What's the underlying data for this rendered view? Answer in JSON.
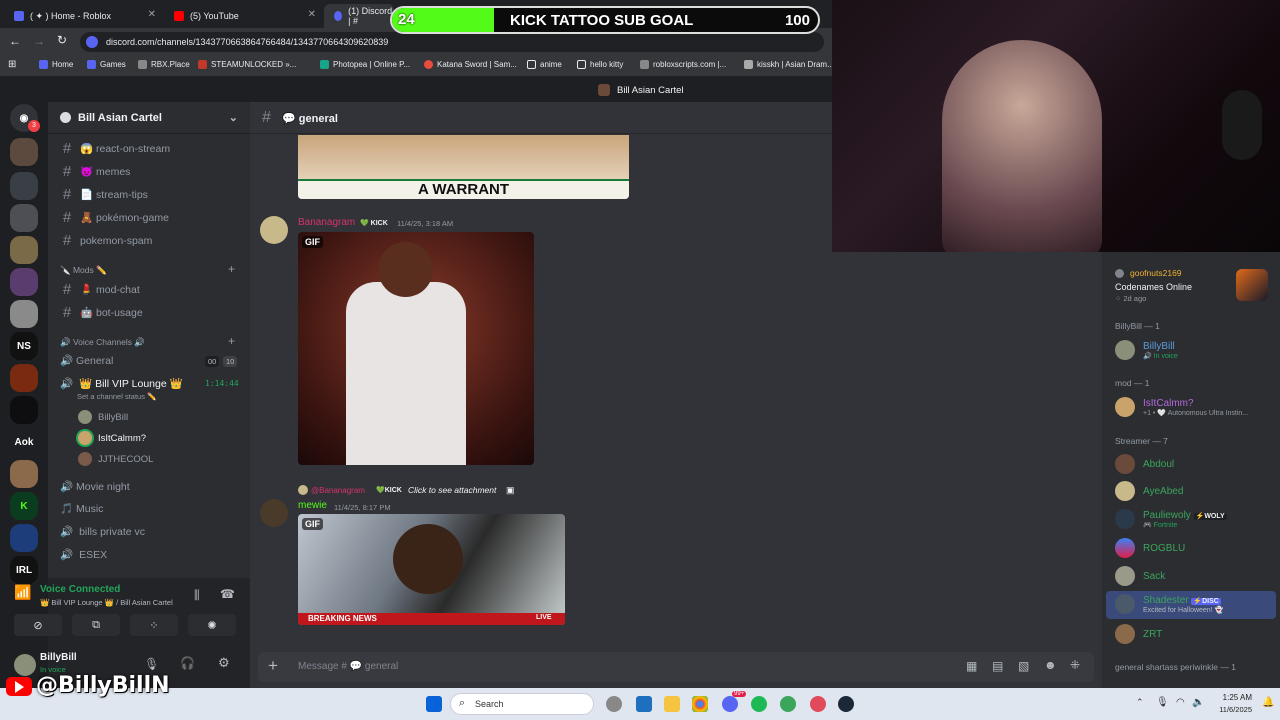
{
  "browser": {
    "tabs": [
      {
        "label": "( ✦ ) Home - Roblox"
      },
      {
        "label": "(5) YouTube"
      },
      {
        "label": "(1) Discord | #"
      }
    ],
    "url": "discord.com/channels/1343770663864766484/1343770664309620839",
    "bookmarks": [
      "Home",
      "Games",
      "RBX.Place",
      "STEAMUNLOCKED »...",
      "Photopea | Online P...",
      "Katana Sword | Sam...",
      "anime",
      "hello kitty",
      "robloxscripts.com |...",
      "kisskh | Asian Dram..."
    ]
  },
  "discord": {
    "server_title": "Bill Asian Cartel",
    "server_name": "Bill Asian Cartel",
    "rail_badge": "3",
    "rail_labels": [
      "NS",
      "Aok",
      "IRL"
    ],
    "channel_header": "general",
    "channels": [
      {
        "label": "😱 react-on-stream"
      },
      {
        "label": "😈 memes"
      },
      {
        "label": "📄 stream-tips"
      },
      {
        "label": "🧸 pokémon-game"
      },
      {
        "label": "pokemon-spam"
      }
    ],
    "mods_category": "🔪 Mods ✏️",
    "mod_channels": [
      {
        "label": "💄 mod-chat"
      },
      {
        "label": "🤖 bot-usage"
      }
    ],
    "voice_category": "🔊 Voice Channels 🔊",
    "voice_channels": [
      {
        "label": "🔊 General",
        "count_a": "00",
        "count_b": "10"
      },
      {
        "label": "👑 Bill VIP Lounge 👑",
        "timer": "1:14:44",
        "status": "Set a channel status ✏️"
      }
    ],
    "voice_users": [
      "BillyBill",
      "IsItCalmm?",
      "JJTHECOOL"
    ],
    "more_voice": [
      "🔊 Movie night",
      "🎵 Music",
      "bills private vc",
      "ESEX"
    ],
    "voice_connected": {
      "title": "Voice Connected",
      "sub": "👑 Bill VIP Lounge 👑 / Bill Asian Cartel"
    },
    "user": {
      "name": "BillyBill",
      "status": "In voice"
    },
    "messages": {
      "image_caption": "A WARRANT",
      "msg1": {
        "author": "Bananagram",
        "badge": "KICK",
        "time": "11/4/25, 3:18 AM",
        "gif": "GIF"
      },
      "reply": {
        "to": "@Bananagram",
        "badge": "KICK",
        "text": "Click to see attachment"
      },
      "msg2": {
        "author": "mewie",
        "time": "11/4/25, 8:17 PM",
        "gif": "GIF",
        "banner": "BREAKING NEWS",
        "live": "LIVE"
      }
    },
    "composer_placeholder": "Message # 💬 general"
  },
  "stream_overlay": {
    "left_value": "24",
    "title": "KICK TATTOO SUB GOAL",
    "right_value": "100",
    "progress_pct": 24
  },
  "members": {
    "activity": {
      "name": "goofnuts2169",
      "game": "Codenames Online",
      "ago": "2d ago"
    },
    "groups": [
      {
        "header": "BillyBill — 1",
        "items": [
          {
            "name": "BillyBill",
            "status": "In voice",
            "color": "#5b9bd5"
          }
        ]
      },
      {
        "header": "mod — 1",
        "items": [
          {
            "name": "IsItCalmm?",
            "status": "+1 • 🤍 Autonomous Ultra Instin...",
            "color": "#b36adf"
          }
        ]
      },
      {
        "header": "Streamer — 7",
        "items": [
          {
            "name": "Abdoul",
            "status": "",
            "color": "#3ba55c"
          },
          {
            "name": "AyeAbed",
            "status": "",
            "color": "#3ba55c"
          },
          {
            "name": "Pauliewoly",
            "status": "Fortnite",
            "color": "#3ba55c",
            "badge": "WOLY"
          },
          {
            "name": "ROGBLU",
            "status": "",
            "color": "#3ba55c"
          },
          {
            "name": "Sack",
            "status": "",
            "color": "#3ba55c"
          },
          {
            "name": "Shadester",
            "status": "Excited for Halloween! 👻",
            "color": "#3ba55c",
            "badge": "DISC"
          },
          {
            "name": "ZRT",
            "status": "",
            "color": "#3ba55c"
          }
        ]
      },
      {
        "header": "general shartass periwinkle — 1",
        "items": []
      }
    ]
  },
  "taskbar": {
    "search": "Search",
    "time": "1:25 AM",
    "date": "11/6/2025",
    "badge": "99+"
  },
  "watermark": "@BillyBillN"
}
